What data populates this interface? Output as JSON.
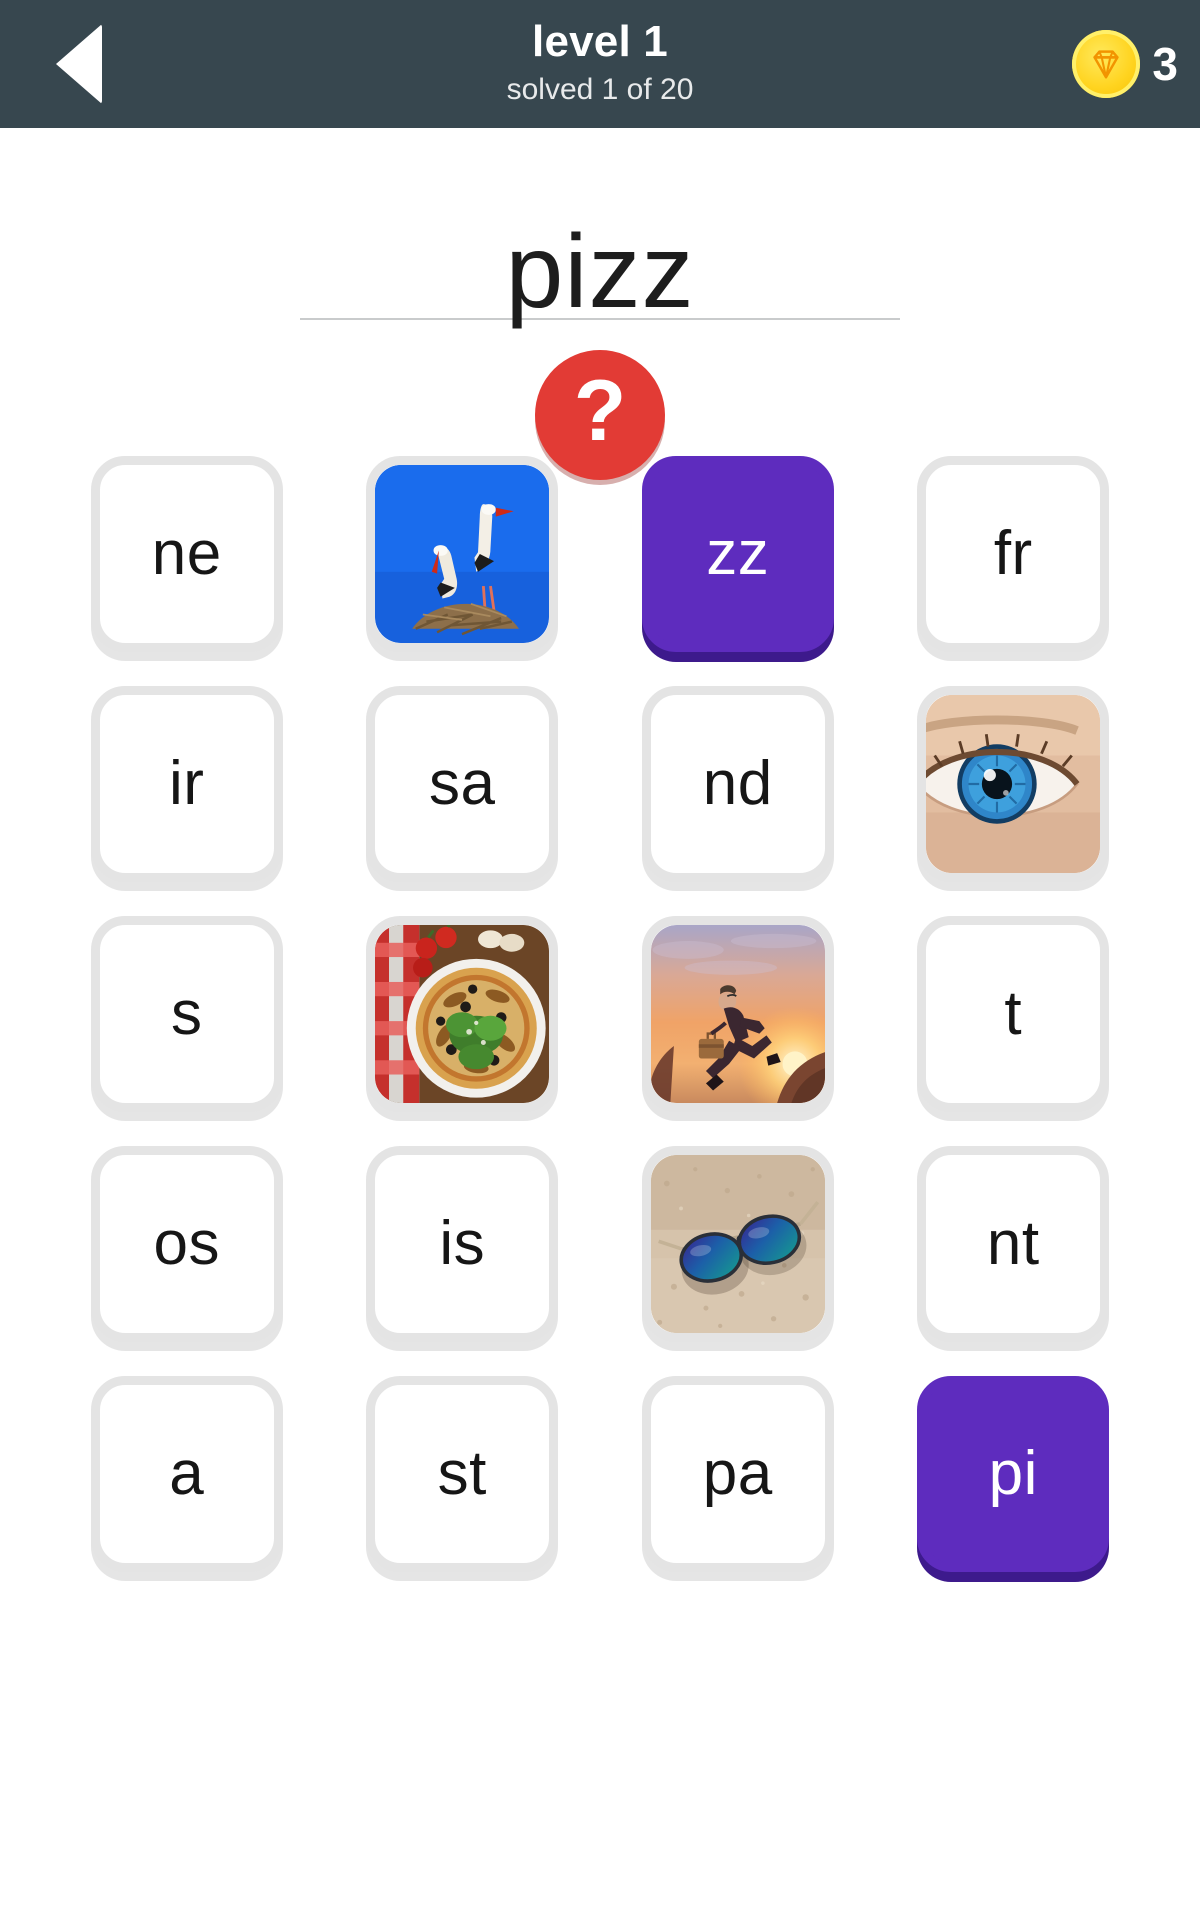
{
  "header": {
    "back_icon": "back-arrow-icon",
    "level_title": "level 1",
    "progress_text": "solved 1 of 20",
    "gem_icon": "gem-icon",
    "gem_count": "3",
    "background_color": "#37474f"
  },
  "puzzle": {
    "current_word": "pizz",
    "hint_label": "?",
    "hint_color": "#e23b35",
    "selected_color": "#5e2cbe"
  },
  "grid": {
    "columns": 4,
    "rows": 5,
    "tiles": [
      {
        "type": "letter",
        "label": "ne",
        "selected": false
      },
      {
        "type": "photo",
        "label": "",
        "image": "storks-on-nest-photo",
        "selected": false
      },
      {
        "type": "letter",
        "label": "zz",
        "selected": true
      },
      {
        "type": "letter",
        "label": "fr",
        "selected": false
      },
      {
        "type": "letter",
        "label": "ir",
        "selected": false
      },
      {
        "type": "letter",
        "label": "sa",
        "selected": false
      },
      {
        "type": "letter",
        "label": "nd",
        "selected": false
      },
      {
        "type": "photo",
        "label": "",
        "image": "blue-eye-photo",
        "selected": false
      },
      {
        "type": "letter",
        "label": "s",
        "selected": false
      },
      {
        "type": "photo",
        "label": "",
        "image": "pizza-photo",
        "selected": false
      },
      {
        "type": "photo",
        "label": "",
        "image": "businessman-jumping-sunset-photo",
        "selected": false
      },
      {
        "type": "letter",
        "label": "t",
        "selected": false
      },
      {
        "type": "letter",
        "label": "os",
        "selected": false
      },
      {
        "type": "letter",
        "label": "is",
        "selected": false
      },
      {
        "type": "photo",
        "label": "",
        "image": "sunglasses-on-sand-photo",
        "selected": false
      },
      {
        "type": "letter",
        "label": "nt",
        "selected": false
      },
      {
        "type": "letter",
        "label": "a",
        "selected": false
      },
      {
        "type": "letter",
        "label": "st",
        "selected": false
      },
      {
        "type": "letter",
        "label": "pa",
        "selected": false
      },
      {
        "type": "letter",
        "label": "pi",
        "selected": true
      }
    ]
  }
}
